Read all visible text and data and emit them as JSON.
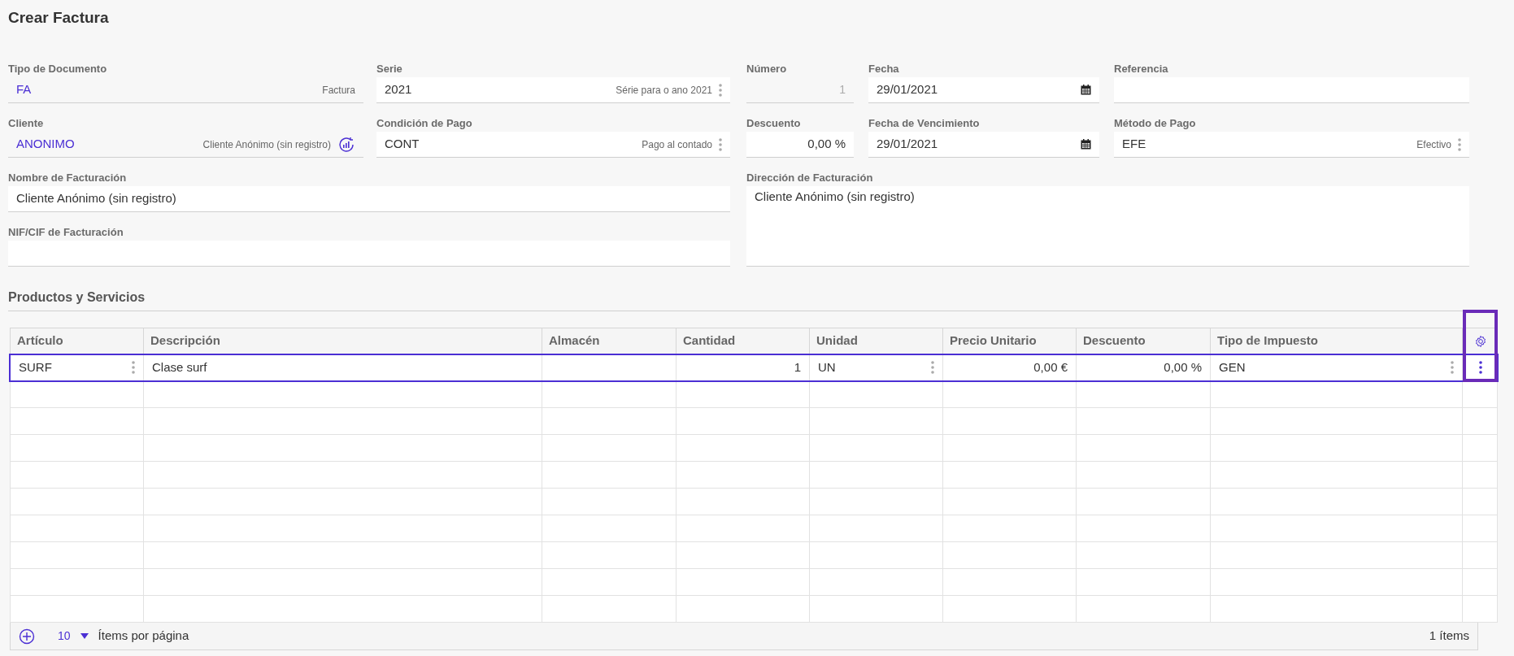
{
  "title": "Crear Factura",
  "fields": [
    {
      "label": "Tipo de Documento",
      "kind": "lookup",
      "value": "FA",
      "description": "Factura",
      "has_action": false
    },
    {
      "label": "Serie",
      "kind": "select",
      "value": "2021",
      "description": "Série para o ano 2021"
    },
    {
      "label": "Número",
      "kind": "readonly",
      "value": "1"
    },
    {
      "label": "Fecha",
      "kind": "date",
      "value": "29/01/2021"
    },
    {
      "label": "Referencia",
      "kind": "text"
    },
    {
      "label": "Cliente",
      "kind": "lookup",
      "value": "ANONIMO",
      "description": "Cliente Anónimo (sin registro)",
      "has_action": true
    },
    {
      "label": "Condición de Pago",
      "kind": "select",
      "value": "CONT",
      "description": "Pago al contado"
    },
    {
      "label": "Descuento",
      "kind": "number",
      "value": "0,00 %"
    },
    {
      "label": "Fecha de Vencimiento",
      "kind": "date",
      "value": "29/01/2021"
    },
    {
      "label": "Método de Pago",
      "kind": "select",
      "value": "EFE",
      "description": "Efectivo"
    },
    {
      "label": "Nombre de Facturación",
      "kind": "text",
      "value": "Cliente Anónimo (sin registro)"
    },
    {
      "label": "Dirección de Facturación",
      "kind": "textarea",
      "value": "Cliente Anónimo (sin registro)"
    },
    {
      "label": "NIF/CIF de Facturación",
      "kind": "text"
    }
  ],
  "section_title": "Productos y Servicios",
  "table": {
    "columns": [
      "Artículo",
      "Descripción",
      "Almacén",
      "Cantidad",
      "Unidad",
      "Precio Unitario",
      "Descuento",
      "Tipo de Impuesto"
    ],
    "rows": [
      {
        "selected": true,
        "cells": [
          {
            "kind": "lookup",
            "text": "SURF"
          },
          {
            "kind": "text",
            "text": "Clase surf"
          },
          {
            "kind": "text"
          },
          {
            "kind": "number",
            "text": "1"
          },
          {
            "kind": "lookup",
            "text": "UN"
          },
          {
            "kind": "number",
            "text": "0,00 €"
          },
          {
            "kind": "number",
            "text": "0,00 %"
          },
          {
            "kind": "lookup",
            "text": "GEN"
          }
        ]
      }
    ],
    "page_size": "10",
    "per_page_label": "Ítems por página",
    "count": "1 ítems"
  }
}
